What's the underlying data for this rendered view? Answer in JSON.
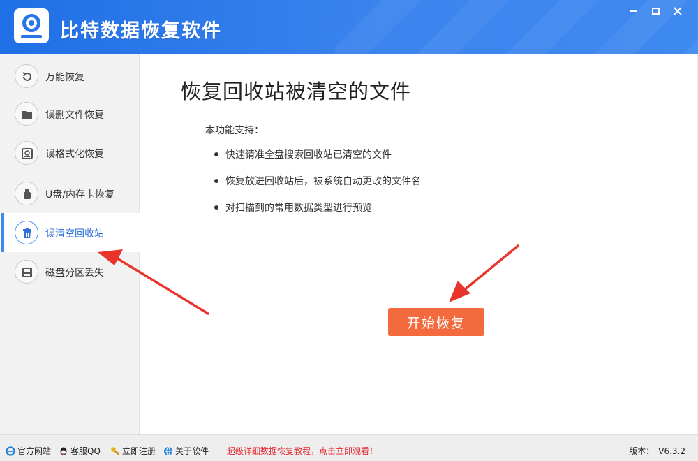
{
  "app": {
    "title": "比特数据恢复软件"
  },
  "sidebar": {
    "items": [
      {
        "label": "万能恢复",
        "icon": "refresh-icon"
      },
      {
        "label": "误删文件恢复",
        "icon": "folder-icon"
      },
      {
        "label": "误格式化恢复",
        "icon": "format-disk-icon"
      },
      {
        "label": "U盘/内存卡恢复",
        "icon": "usb-icon"
      },
      {
        "label": "误清空回收站",
        "icon": "trash-icon",
        "active": true
      },
      {
        "label": "磁盘分区丢失",
        "icon": "disk-icon"
      }
    ]
  },
  "main": {
    "title": "恢复回收站被清空的文件",
    "support_label": "本功能支持：",
    "features": [
      "快速请准全盘搜索回收站已清空的文件",
      "恢复放进回收站后，被系统自动更改的文件名",
      "对扫描到的常用数据类型进行预览"
    ],
    "start_button": "开始恢复"
  },
  "footer": {
    "links": [
      {
        "label": "官方网站",
        "icon": "ie-icon"
      },
      {
        "label": "客服QQ",
        "icon": "qq-icon"
      },
      {
        "label": "立即注册",
        "icon": "key-icon"
      },
      {
        "label": "关于软件",
        "icon": "info-globe-icon"
      }
    ],
    "promo": "超级详细数据恢复教程，点击立即观看！",
    "version_label": "版本：",
    "version_value": "V6.3.2"
  },
  "colors": {
    "header_blue": "#2a76e8",
    "accent_orange": "#f26a3d",
    "active_blue": "#3d87ef",
    "promo_red": "#e3262d",
    "arrow_red": "#e8342b"
  }
}
